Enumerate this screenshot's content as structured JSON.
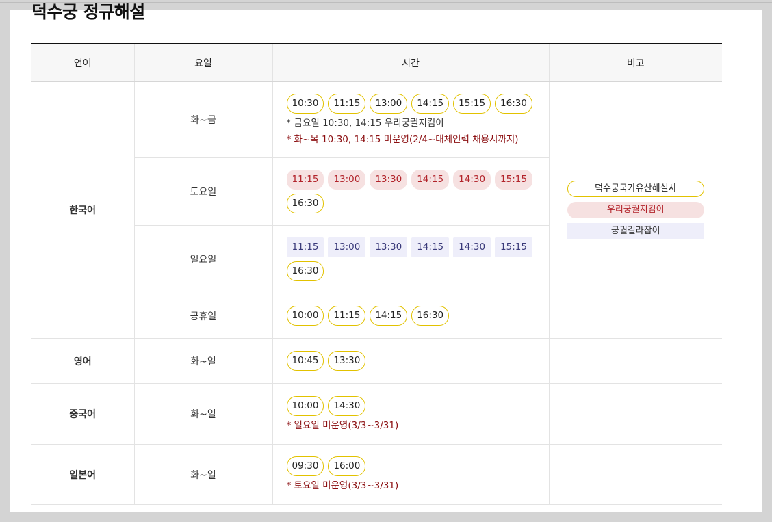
{
  "title": "덕수궁 정규해설",
  "headers": {
    "language": "언어",
    "day": "요일",
    "time": "시간",
    "remarks": "비고"
  },
  "legend": [
    {
      "label": "덕수궁국가유산해설사",
      "style": "yellow"
    },
    {
      "label": "우리궁궐지킴이",
      "style": "pink"
    },
    {
      "label": "궁궐길라잡이",
      "style": "lav"
    }
  ],
  "rows": [
    {
      "language": "한국어",
      "day": "화~금",
      "chips": [
        {
          "t": "10:30",
          "s": "yellow"
        },
        {
          "t": "11:15",
          "s": "yellow"
        },
        {
          "t": "13:00",
          "s": "yellow"
        },
        {
          "t": "14:15",
          "s": "yellow"
        },
        {
          "t": "15:15",
          "s": "yellow"
        },
        {
          "t": "16:30",
          "s": "yellow"
        }
      ],
      "notes": [
        {
          "text": "* 금요일 10:30, 14:15 우리궁궐지킴이",
          "style": "gray"
        },
        {
          "text": "* 화~목 10:30, 14:15 미운영(2/4~대체인력 채용시까지)",
          "style": "red"
        }
      ]
    },
    {
      "language": "",
      "day": "토요일",
      "chips": [
        {
          "t": "11:15",
          "s": "pink"
        },
        {
          "t": "13:00",
          "s": "pink"
        },
        {
          "t": "13:30",
          "s": "pink"
        },
        {
          "t": "14:15",
          "s": "pink"
        },
        {
          "t": "14:30",
          "s": "pink"
        },
        {
          "t": "15:15",
          "s": "pink"
        },
        {
          "t": "16:30",
          "s": "yellow"
        }
      ],
      "notes": []
    },
    {
      "language": "",
      "day": "일요일",
      "chips": [
        {
          "t": "11:15",
          "s": "lav"
        },
        {
          "t": "13:00",
          "s": "lav"
        },
        {
          "t": "13:30",
          "s": "lav"
        },
        {
          "t": "14:15",
          "s": "lav"
        },
        {
          "t": "14:30",
          "s": "lav"
        },
        {
          "t": "15:15",
          "s": "lav"
        },
        {
          "t": "16:30",
          "s": "yellow"
        }
      ],
      "notes": []
    },
    {
      "language": "",
      "day": "공휴일",
      "chips": [
        {
          "t": "10:00",
          "s": "yellow"
        },
        {
          "t": "11:15",
          "s": "yellow"
        },
        {
          "t": "14:15",
          "s": "yellow"
        },
        {
          "t": "16:30",
          "s": "yellow"
        }
      ],
      "notes": []
    },
    {
      "language": "영어",
      "day": "화~일",
      "chips": [
        {
          "t": "10:45",
          "s": "yellow"
        },
        {
          "t": "13:30",
          "s": "yellow"
        }
      ],
      "notes": []
    },
    {
      "language": "중국어",
      "day": "화~일",
      "chips": [
        {
          "t": "10:00",
          "s": "yellow"
        },
        {
          "t": "14:30",
          "s": "yellow"
        }
      ],
      "notes": [
        {
          "text": "* 일요일 미운영(3/3~3/31)",
          "style": "red"
        }
      ]
    },
    {
      "language": "일본어",
      "day": "화~일",
      "chips": [
        {
          "t": "09:30",
          "s": "yellow"
        },
        {
          "t": "16:00",
          "s": "yellow"
        }
      ],
      "notes": [
        {
          "text": "* 토요일 미운영(3/3~3/31)",
          "style": "red"
        }
      ]
    }
  ]
}
